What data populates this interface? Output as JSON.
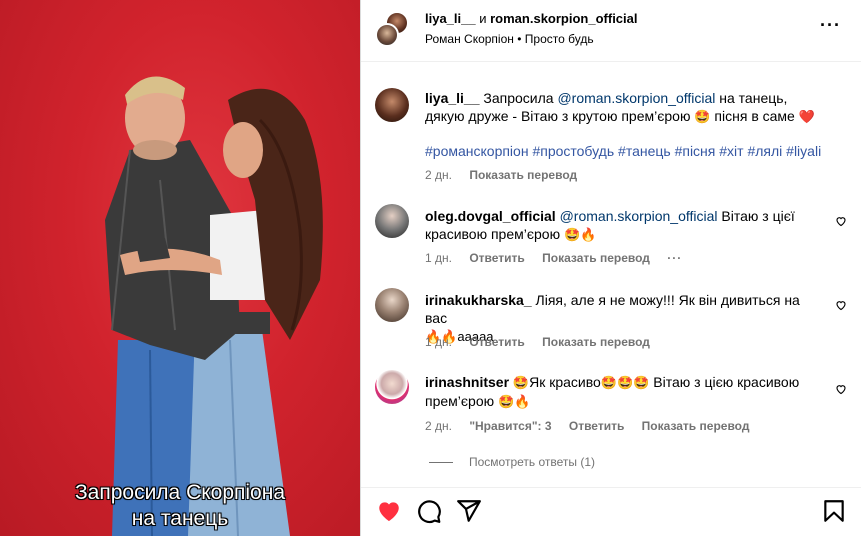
{
  "media": {
    "caption_line1": "Запросила Скорпіона",
    "caption_line2": "на танець"
  },
  "header": {
    "user1": "liya_li__",
    "connector": "и",
    "user2": "roman.skorpion_official",
    "music": "Роман Скорпіон • Просто будь"
  },
  "post": {
    "username": "liya_li__",
    "text_a": "Запросила",
    "mention": "@roman.skorpion_official",
    "text_b": "на танець, дякую друже - Вітаю з крутою прем’єрою",
    "emoji1": "🤩",
    "text_c": "пісня в саме",
    "emoji2": "❤️",
    "hashtags": "#романскорпіон #простобудь #танець #пісня #хіт #лялі #liyali",
    "time": "2 дн.",
    "translate": "Показать перевод"
  },
  "comments": [
    {
      "username": "oleg.dovgal_official",
      "mention": "@roman.skorpion_official",
      "text": "Вітаю з цієї красивою прем’єрою",
      "emoji": "🤩🔥",
      "time": "1 дн.",
      "reply": "Ответить",
      "translate": "Показать перевод",
      "more": "···"
    },
    {
      "username": "irinakukharska_",
      "text": "Ліяя, але я не можу!!! Як він дивиться на вас",
      "text2": "🔥🔥ааааа",
      "time": "1 дн.",
      "reply": "Ответить",
      "translate": "Показать перевод"
    },
    {
      "username": "irinashnitser",
      "e1": "🤩",
      "t1": "Як красиво",
      "e2": "🤩🤩🤩",
      "t2": "Вітаю з цією красивою прем’єрою",
      "e3": "🤩🔥",
      "time": "2 дн.",
      "likes": "\"Нравится\": 3",
      "reply": "Ответить",
      "translate": "Показать перевод"
    }
  ],
  "view_replies": "Посмотреть ответы (1)",
  "icons": [
    "like-heart-icon",
    "comment-icon",
    "share-icon",
    "save-bookmark-icon",
    "more-icon"
  ],
  "colors": {
    "background_red": "#d1232d",
    "like_red": "#ff3040",
    "link_blue": "#00376b",
    "meta_gray": "#737373"
  }
}
